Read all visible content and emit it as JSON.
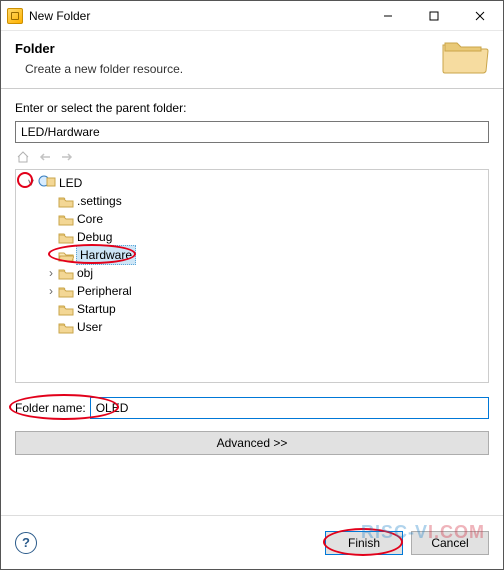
{
  "titlebar": {
    "title": "New Folder"
  },
  "header": {
    "heading": "Folder",
    "subtitle": "Create a new folder resource."
  },
  "body": {
    "prompt": "Enter or select the parent folder:",
    "parent_path": "LED/Hardware",
    "tree": {
      "root": {
        "label": "LED"
      },
      "children": [
        {
          "label": ".settings",
          "expandable": false
        },
        {
          "label": "Core",
          "expandable": false
        },
        {
          "label": "Debug",
          "expandable": false
        },
        {
          "label": "Hardware",
          "expandable": false,
          "selected": true,
          "open": true
        },
        {
          "label": "obj",
          "expandable": true
        },
        {
          "label": "Peripheral",
          "expandable": true
        },
        {
          "label": "Startup",
          "expandable": false
        },
        {
          "label": "User",
          "expandable": false
        }
      ]
    },
    "folder_name_label": "Folder name:",
    "folder_name_value": "OLED",
    "advanced_label": "Advanced >>"
  },
  "footer": {
    "finish_label": "Finish",
    "cancel_label": "Cancel"
  },
  "watermark": {
    "part1": "RISC-V",
    "part2": "I.COM"
  }
}
